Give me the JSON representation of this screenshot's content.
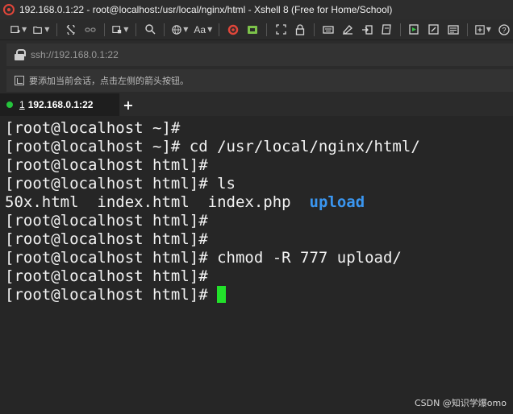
{
  "window": {
    "title": "192.168.0.1:22 - root@localhost:/usr/local/nginx/html - Xshell 8 (Free for Home/School)",
    "app_icon": "xshell-logo-icon"
  },
  "toolbar": {
    "font_size_label": "Aa",
    "icons": [
      "new-session-icon",
      "open-folder-icon",
      "reconnect-icon",
      "disconnect-icon",
      "session-manager-icon",
      "search-icon",
      "globe-icon",
      "font-icon",
      "xshell-icon",
      "xftp-icon",
      "fullscreen-icon",
      "lock-icon",
      "keyboard-icon",
      "highlight-icon",
      "transfer-icon",
      "script-icon",
      "start-icon",
      "compose-icon",
      "notes-icon",
      "add-icon",
      "help-icon"
    ]
  },
  "address": {
    "url": "ssh://192.168.0.1:22"
  },
  "hint": {
    "text": "要添加当前会话，点击左侧的箭头按钮。"
  },
  "tabs": [
    {
      "number": "1",
      "label": "192.168.0.1:22",
      "status_color": "#25c43c"
    }
  ],
  "terminal": {
    "lines": [
      "[root@localhost ~]#",
      "[root@localhost ~]# cd /usr/local/nginx/html/",
      "[root@localhost html]#",
      "[root@localhost html]# ls",
      "LS_OUTPUT",
      "[root@localhost html]#",
      "[root@localhost html]#",
      "[root@localhost html]# chmod -R 777 upload/",
      "[root@localhost html]#",
      "[root@localhost html]# "
    ],
    "ls_files": "50x.html  index.html  index.php  ",
    "ls_dir": "upload",
    "dir_color": "#3a96f0",
    "cursor_color": "#22e12a"
  },
  "watermark": "CSDN @知识学爆omo"
}
